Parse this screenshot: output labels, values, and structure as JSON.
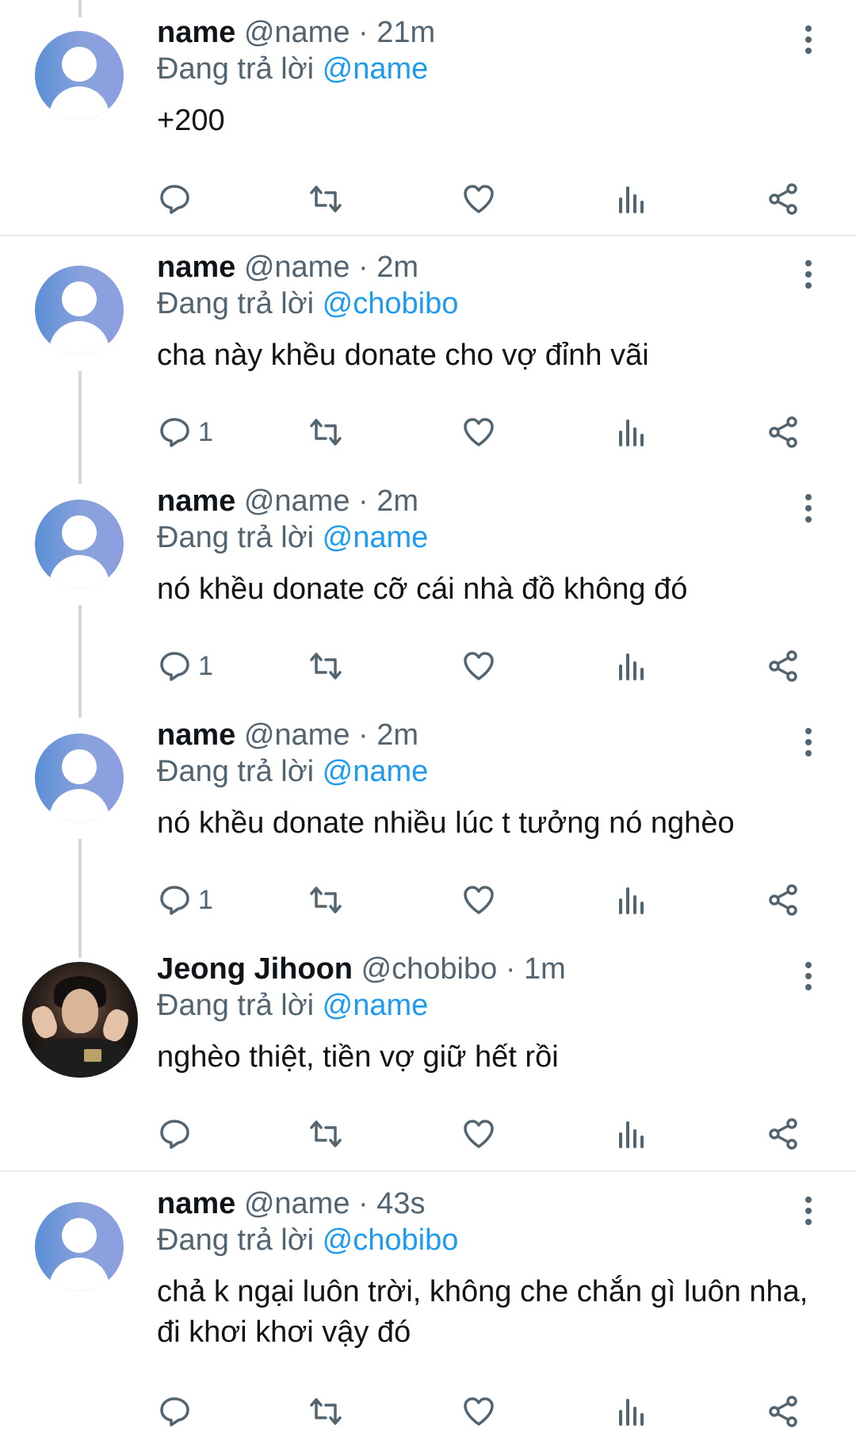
{
  "reply_prefix": "Đang trả lời",
  "colors": {
    "accent": "#1d9bf0",
    "muted": "#536471",
    "text": "#0f1419",
    "divider": "#e7e9eb",
    "thread_line": "#cfd9de"
  },
  "icons": [
    "reply-icon",
    "retweet-icon",
    "like-icon",
    "views-icon",
    "share-icon",
    "more-icon",
    "default-avatar-icon"
  ],
  "tweets": [
    {
      "name": "name",
      "handle": "@name",
      "time": "21m",
      "reply_to": "@name",
      "text": "+200",
      "reply_count": ""
    },
    {
      "name": "name",
      "handle": "@name",
      "time": "2m",
      "reply_to": "@chobibo",
      "text": "cha này khều donate cho vợ đỉnh vãi",
      "reply_count": "1"
    },
    {
      "name": "name",
      "handle": "@name",
      "time": "2m",
      "reply_to": "@name",
      "text": "nó khều donate cỡ cái nhà đồ không đó",
      "reply_count": "1"
    },
    {
      "name": "name",
      "handle": "@name",
      "time": "2m",
      "reply_to": "@name",
      "text": "nó khều donate nhiều lúc t tưởng nó nghèo",
      "reply_count": "1"
    },
    {
      "name": "Jeong Jihoon",
      "handle": "@chobibo",
      "time": "1m",
      "reply_to": "@name",
      "text": "nghèo thiệt, tiền vợ giữ hết rồi",
      "reply_count": ""
    },
    {
      "name": "name",
      "handle": "@name",
      "time": "43s",
      "reply_to": "@chobibo",
      "text": "chả k ngại luôn trời, không che chắn gì luôn nha, đi khơi khơi vậy đó",
      "reply_count": ""
    }
  ]
}
